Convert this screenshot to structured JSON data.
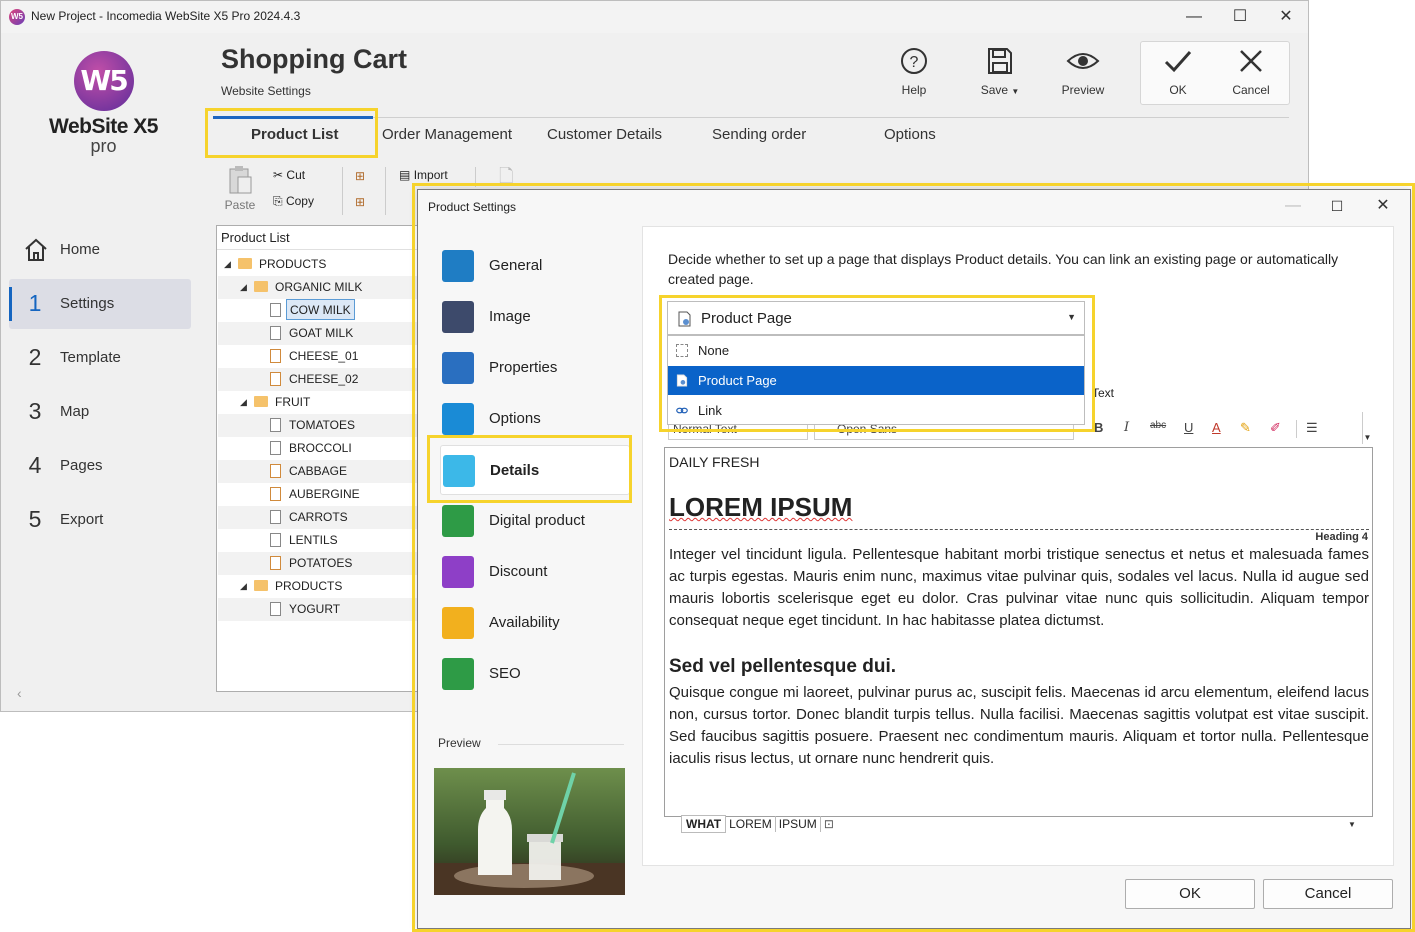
{
  "window": {
    "title": "New Project - Incomedia WebSite X5 Pro 2024.4.3"
  },
  "logo": {
    "mark": "W5",
    "name": "WebSite X5",
    "edition": "pro"
  },
  "nav": [
    {
      "num": "",
      "label": "Home"
    },
    {
      "num": "1",
      "label": "Settings"
    },
    {
      "num": "2",
      "label": "Template"
    },
    {
      "num": "3",
      "label": "Map"
    },
    {
      "num": "4",
      "label": "Pages"
    },
    {
      "num": "5",
      "label": "Export"
    }
  ],
  "header": {
    "title": "Shopping Cart",
    "subtitle": "Website Settings"
  },
  "tools": {
    "help": "Help",
    "save": "Save",
    "preview": "Preview",
    "ok": "OK",
    "cancel": "Cancel"
  },
  "tabs": [
    "Product List",
    "Order Management",
    "Customer Details",
    "Sending order",
    "Options"
  ],
  "small_toolbar": {
    "paste": "Paste",
    "cut": "Cut",
    "copy": "Copy",
    "import": "Import"
  },
  "tree": {
    "header": "Product List",
    "rows": [
      {
        "label": "PRODUCTS",
        "level": 0,
        "type": "folder",
        "twisty": "◢"
      },
      {
        "label": "ORGANIC MILK",
        "level": 1,
        "type": "folder",
        "twisty": "◢"
      },
      {
        "label": "COW MILK",
        "level": 2,
        "type": "page",
        "selected": true
      },
      {
        "label": "GOAT MILK",
        "level": 2,
        "type": "page"
      },
      {
        "label": "CHEESE_01",
        "level": 2,
        "type": "page-orange"
      },
      {
        "label": "CHEESE_02",
        "level": 2,
        "type": "page-orange"
      },
      {
        "label": "FRUIT",
        "level": 1,
        "type": "folder",
        "twisty": "◢"
      },
      {
        "label": "TOMATOES",
        "level": 2,
        "type": "page"
      },
      {
        "label": "BROCCOLI",
        "level": 2,
        "type": "page"
      },
      {
        "label": "CABBAGE",
        "level": 2,
        "type": "page-orange"
      },
      {
        "label": "AUBERGINE",
        "level": 2,
        "type": "page-orange"
      },
      {
        "label": "CARROTS",
        "level": 2,
        "type": "page"
      },
      {
        "label": "LENTILS",
        "level": 2,
        "type": "page"
      },
      {
        "label": "POTATOES",
        "level": 2,
        "type": "page-orange"
      },
      {
        "label": "PRODUCTS",
        "level": 1,
        "type": "folder",
        "twisty": "◢"
      },
      {
        "label": "YOGURT",
        "level": 2,
        "type": "page"
      }
    ]
  },
  "dialog": {
    "title": "Product Settings",
    "categories": [
      {
        "label": "General",
        "icon": "general-icon",
        "color": "#1f7dc4"
      },
      {
        "label": "Image",
        "icon": "camera-icon",
        "color": "#3d4a6b"
      },
      {
        "label": "Properties",
        "icon": "list-icon",
        "color": "#2a6fc0"
      },
      {
        "label": "Options",
        "icon": "layers-icon",
        "color": "#1a8bd6"
      },
      {
        "label": "Details",
        "icon": "folder-icon",
        "color": "#3cb8e8"
      },
      {
        "label": "Digital product",
        "icon": "download-icon",
        "color": "#2e9b46"
      },
      {
        "label": "Discount",
        "icon": "discount-icon",
        "color": "#8e3fc7"
      },
      {
        "label": "Availability",
        "icon": "availability-icon",
        "color": "#f2b01e"
      },
      {
        "label": "SEO",
        "icon": "seo-icon",
        "color": "#2e9b46"
      }
    ],
    "preview_label": "Preview",
    "description": "Decide whether to set up a page that displays Product details. You can link an existing page or automatically created page.",
    "combo": {
      "value": "Product Page",
      "options": [
        "None",
        "Product Page",
        "Link"
      ]
    },
    "editor_toolbar": {
      "style": "Normal Text",
      "font": "Open Sans",
      "text_suffix": "Text"
    },
    "editor": {
      "small": "DAILY FRESH",
      "h1": "LOREM IPSUM",
      "heading_marker": "Heading 4",
      "p1": "Integer vel tincidunt ligula. Pellentesque habitant morbi tristique senectus et netus et malesuada fames ac turpis egestas. Mauris enim nunc, maximus vitae pulvinar quis, sodales vel lacus. Nulla id augue sed mauris lobortis scelerisque eget eu dolor. Cras pulvinar vitae nunc quis sollicitudin. Aliquam tempor consequat neque eget tincidunt. In hac habitasse platea dictumst.",
      "h2": "Sed vel pellentesque dui.",
      "p2": "Quisque congue mi laoreet, pulvinar purus ac, suscipit felis. Maecenas id arcu elementum, eleifend lacus non, cursus tortor. Donec blandit turpis tellus. Nulla facilisi. Maecenas sagittis volutpat est vitae suscipit. Sed faucibus sagittis posuere. Praesent nec condimentum mauris. Aliquam et tortor nulla. Pellentesque iaculis risus lectus, ut ornare nunc hendrerit quis."
    },
    "tags": [
      "WHAT",
      "LOREM",
      "IPSUM"
    ],
    "ok": "OK",
    "cancel": "Cancel"
  },
  "colors": {
    "accent": "#1565c0",
    "highlight": "#f6d32c",
    "selection": "#0a63c9"
  }
}
